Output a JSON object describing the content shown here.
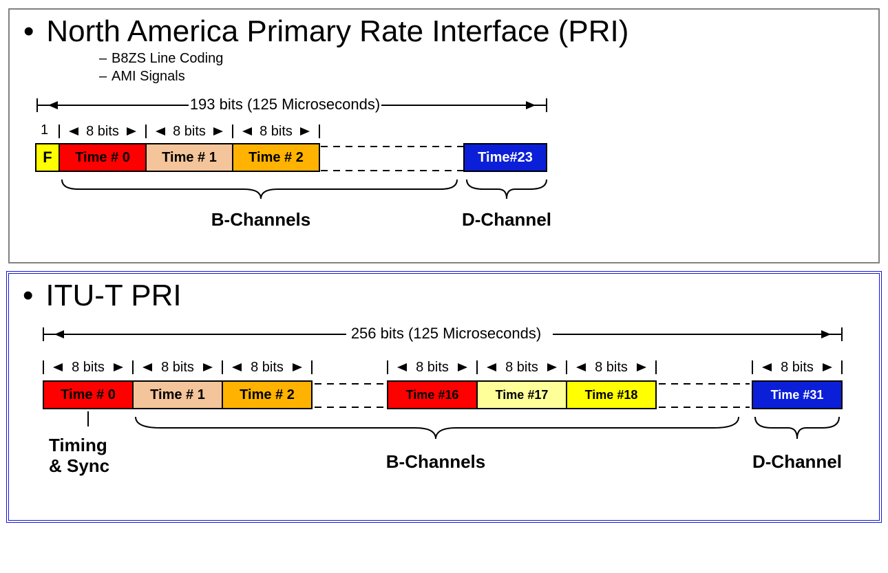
{
  "na": {
    "title": "North America Primary Rate Interface (PRI)",
    "sub1": "B8ZS Line Coding",
    "sub2": "AMI Signals",
    "span": "193 bits (125 Microseconds)",
    "framebit": "1",
    "eight": "8 bits",
    "fLabel": "F",
    "s0": "Time # 0",
    "s1": "Time # 1",
    "s2": "Time # 2",
    "s23": "Time#23",
    "bch": "B-Channels",
    "dch": "D-Channel"
  },
  "itu": {
    "title": "ITU-T PRI",
    "span": "256 bits (125 Microseconds)",
    "eight": "8 bits",
    "s0": "Time # 0",
    "s1": "Time # 1",
    "s2": "Time # 2",
    "s16": "Time #16",
    "s17": "Time #17",
    "s18": "Time #18",
    "s31": "Time #31",
    "timing": "Timing",
    "sync": "& Sync",
    "bch": "B-Channels",
    "dch": "D-Channel"
  }
}
